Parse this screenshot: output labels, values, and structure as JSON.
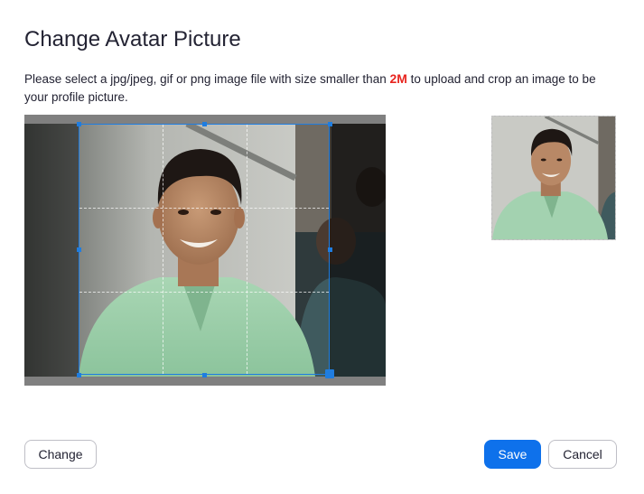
{
  "dialog": {
    "title": "Change Avatar Picture",
    "description_before": "Please select a jpg/jpeg, gif or png image file with size smaller than ",
    "size_limit": "2M",
    "description_after": " to upload and crop an image to be your profile picture."
  },
  "buttons": {
    "change": "Change",
    "save": "Save",
    "cancel": "Cancel"
  },
  "colors": {
    "primary": "#0e71eb",
    "highlight": "#e8251f",
    "crop_border": "#1f7de0"
  }
}
